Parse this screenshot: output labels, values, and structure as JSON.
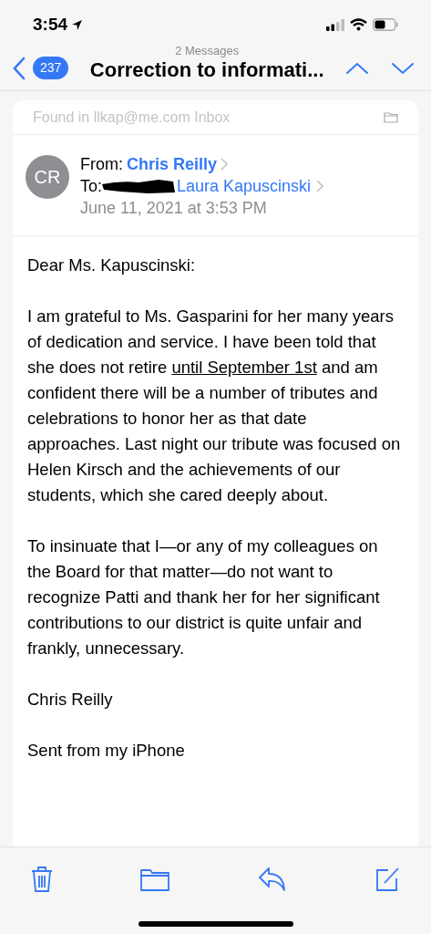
{
  "status_bar": {
    "time": "3:54"
  },
  "nav": {
    "back_count": "237",
    "subtitle": "2 Messages",
    "title": "Correction to informati..."
  },
  "found_in": "Found in llkap@me.com Inbox",
  "header": {
    "avatar": "CR",
    "from_label": "From:",
    "from_name": "Chris Reilly",
    "to_label": "To:",
    "to_name": "Laura Kapuscinski",
    "date": "June 11, 2021 at 3:53 PM"
  },
  "body": [
    {
      "text": "Dear Ms. Kapuscinski:"
    },
    {
      "text": "I am grateful to Ms. Gasparini for her many years of dedication and service.  I have been told that she does not retire",
      "link": "until September 1st",
      "after": "and am confident there will be a number of tributes and celebrations to honor her as that date approaches. Last night our tribute was focused on Helen Kirsch and the achievements of our students, which she cared deeply about."
    },
    {
      "text": "To insinuate that I—or any of my colleagues on the Board for that matter—do not want to recognize Patti and thank her for her significant contributions to our district is quite unfair and frankly, unnecessary."
    },
    {
      "text": "Chris Reilly"
    },
    {
      "text": "Sent from my iPhone"
    }
  ]
}
